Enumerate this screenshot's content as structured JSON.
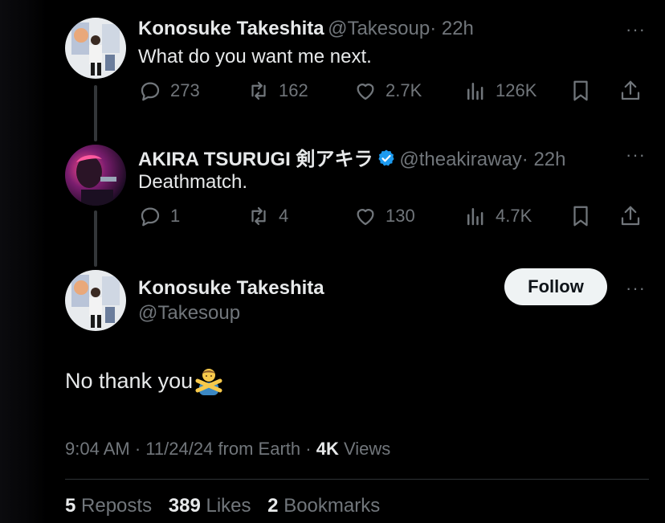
{
  "tweet1": {
    "name": "Konosuke Takeshita",
    "handle": "@Takesoup",
    "time": "· 22h",
    "text": "What do you want me next.",
    "replies": "273",
    "reposts": "162",
    "likes": "2.7K",
    "views": "126K"
  },
  "tweet2": {
    "name": "AKIRA TSURUGI 剣アキラ",
    "handle": "@theakiraway",
    "time": "· 22h",
    "text": "Deathmatch.",
    "replies": "1",
    "reposts": "4",
    "likes": "130",
    "views": "4.7K"
  },
  "main": {
    "name": "Konosuke Takeshita",
    "handle": "@Takesoup",
    "follow_label": "Follow",
    "text": "No thank you",
    "emoji": "🙅‍♂️",
    "time": "9:04 AM",
    "date": "11/24/24",
    "location": "from Earth",
    "views_count": "4K",
    "views_label": "Views",
    "reposts_count": "5",
    "reposts_label": "Reposts",
    "likes_count": "389",
    "likes_label": "Likes",
    "bookmarks_count": "2",
    "bookmarks_label": "Bookmarks"
  },
  "more_glyph": "···",
  "colors": {
    "background": "#000000",
    "text": "#e7e9ea",
    "muted": "#71767b",
    "verified": "#1d9bf0",
    "follow_bg": "#eff3f4"
  },
  "icons": [
    "reply-icon",
    "repost-icon",
    "like-icon",
    "views-icon",
    "bookmark-icon",
    "share-icon",
    "more-icon",
    "verified-icon"
  ]
}
